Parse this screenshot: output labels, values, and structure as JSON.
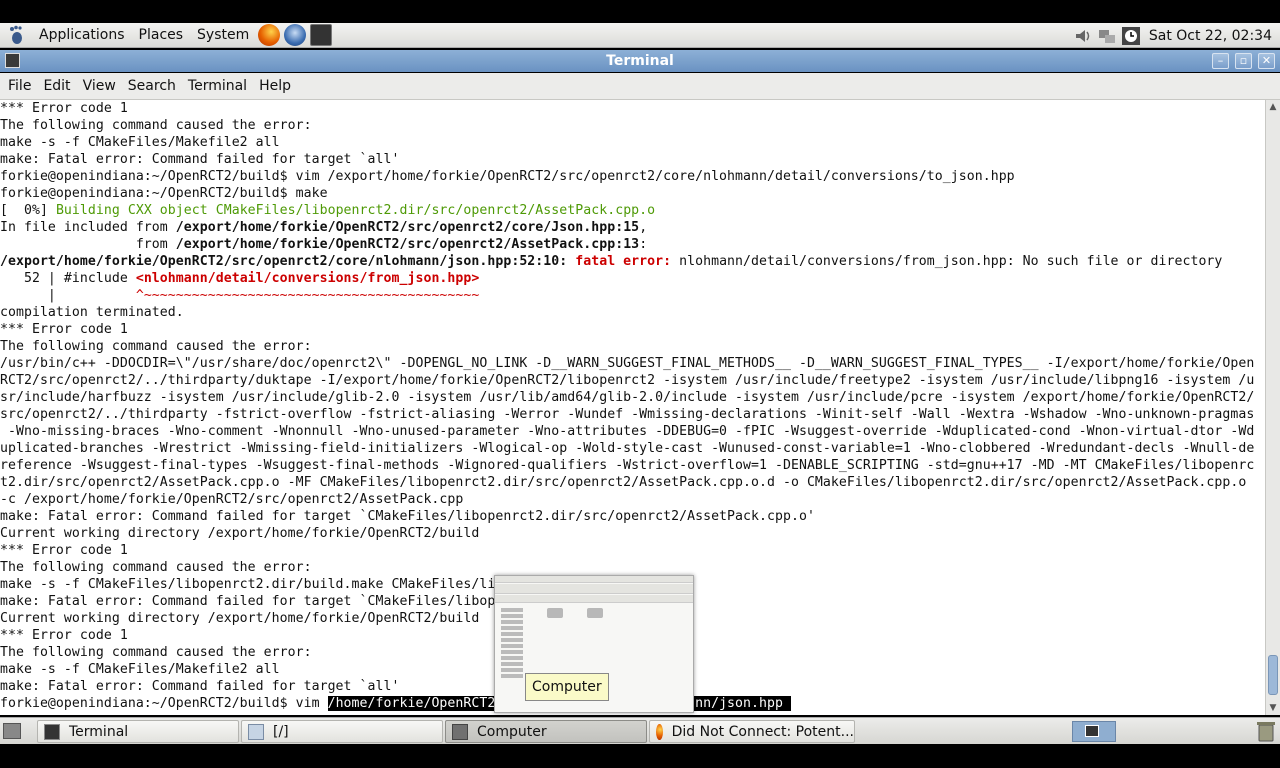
{
  "top_panel": {
    "menus": [
      "Applications",
      "Places",
      "System"
    ],
    "launchers": [
      "firefox-icon",
      "thunderbird-icon",
      "terminal-icon"
    ],
    "clock": "Sat Oct 22, 02:34"
  },
  "window": {
    "title": "Terminal",
    "menubar": [
      "File",
      "Edit",
      "View",
      "Search",
      "Terminal",
      "Help"
    ]
  },
  "terminal": {
    "lines": [
      [
        {
          "t": "*** Error code 1"
        }
      ],
      [
        {
          "t": "The following command caused the error:"
        }
      ],
      [
        {
          "t": "make -s -f CMakeFiles/Makefile2 all"
        }
      ],
      [
        {
          "t": "make: Fatal error: Command failed for target `all'"
        }
      ],
      [
        {
          "t": "forkie@openindiana:~/OpenRCT2/build$ vim /export/home/forkie/OpenRCT2/src/openrct2/core/nlohmann/detail/conversions/to_json.hpp"
        }
      ],
      [
        {
          "t": "forkie@openindiana:~/OpenRCT2/build$ make"
        }
      ],
      [
        {
          "t": "[  0%] "
        },
        {
          "t": "Building CXX object CMakeFiles/libopenrct2.dir/src/openrct2/AssetPack.cpp.o",
          "c": "green"
        }
      ],
      [
        {
          "t": "In file included from "
        },
        {
          "t": "/export/home/forkie/OpenRCT2/src/openrct2/core/Json.hpp:15",
          "c": "bold"
        },
        {
          "t": ","
        }
      ],
      [
        {
          "t": "                 from "
        },
        {
          "t": "/export/home/forkie/OpenRCT2/src/openrct2/AssetPack.cpp:13",
          "c": "bold"
        },
        {
          "t": ":"
        }
      ],
      [
        {
          "t": "/export/home/forkie/OpenRCT2/src/openrct2/core/nlohmann/json.hpp:52:10: ",
          "c": "bold"
        },
        {
          "t": "fatal error: ",
          "c": "redbold"
        },
        {
          "t": "nlohmann/detail/conversions/from_json.hpp: No such file or directory"
        }
      ],
      [
        {
          "t": "   52 | #include "
        },
        {
          "t": "<nlohmann/detail/conversions/from_json.hpp>",
          "c": "redbold"
        }
      ],
      [
        {
          "t": "      |          "
        },
        {
          "t": "^~~~~~~~~~~~~~~~~~~~~~~~~~~~~~~~~~~~~~~~~~~",
          "c": "red"
        }
      ],
      [
        {
          "t": "compilation terminated."
        }
      ],
      [
        {
          "t": "*** Error code 1"
        }
      ],
      [
        {
          "t": "The following command caused the error:"
        }
      ],
      [
        {
          "t": "/usr/bin/c++ -DDOCDIR=\\\"/usr/share/doc/openrct2\\\" -DOPENGL_NO_LINK -D__WARN_SUGGEST_FINAL_METHODS__ -D__WARN_SUGGEST_FINAL_TYPES__ -I/export/home/forkie/Open"
        }
      ],
      [
        {
          "t": "RCT2/src/openrct2/../thirdparty/duktape -I/export/home/forkie/OpenRCT2/libopenrct2 -isystem /usr/include/freetype2 -isystem /usr/include/libpng16 -isystem /u"
        }
      ],
      [
        {
          "t": "sr/include/harfbuzz -isystem /usr/include/glib-2.0 -isystem /usr/lib/amd64/glib-2.0/include -isystem /usr/include/pcre -isystem /export/home/forkie/OpenRCT2/"
        }
      ],
      [
        {
          "t": "src/openrct2/../thirdparty -fstrict-overflow -fstrict-aliasing -Werror -Wundef -Wmissing-declarations -Winit-self -Wall -Wextra -Wshadow -Wno-unknown-pragmas"
        }
      ],
      [
        {
          "t": " -Wno-missing-braces -Wno-comment -Wnonnull -Wno-unused-parameter -Wno-attributes -DDEBUG=0 -fPIC -Wsuggest-override -Wduplicated-cond -Wnon-virtual-dtor -Wd"
        }
      ],
      [
        {
          "t": "uplicated-branches -Wrestrict -Wmissing-field-initializers -Wlogical-op -Wold-style-cast -Wunused-const-variable=1 -Wno-clobbered -Wredundant-decls -Wnull-de"
        }
      ],
      [
        {
          "t": "reference -Wsuggest-final-types -Wsuggest-final-methods -Wignored-qualifiers -Wstrict-overflow=1 -DENABLE_SCRIPTING -std=gnu++17 -MD -MT CMakeFiles/libopenrc"
        }
      ],
      [
        {
          "t": "t2.dir/src/openrct2/AssetPack.cpp.o -MF CMakeFiles/libopenrct2.dir/src/openrct2/AssetPack.cpp.o.d -o CMakeFiles/libopenrct2.dir/src/openrct2/AssetPack.cpp.o"
        }
      ],
      [
        {
          "t": "-c /export/home/forkie/OpenRCT2/src/openrct2/AssetPack.cpp"
        }
      ],
      [
        {
          "t": "make: Fatal error: Command failed for target `CMakeFiles/libopenrct2.dir/src/openrct2/AssetPack.cpp.o'"
        }
      ],
      [
        {
          "t": "Current working directory /export/home/forkie/OpenRCT2/build"
        }
      ],
      [
        {
          "t": "*** Error code 1"
        }
      ],
      [
        {
          "t": "The following command caused the error:"
        }
      ],
      [
        {
          "t": "make -s -f CMakeFiles/libopenrct2.dir/build.make CMakeFiles/li"
        }
      ],
      [
        {
          "t": "make: Fatal error: Command failed for target `CMakeFiles/libop"
        }
      ],
      [
        {
          "t": "Current working directory /export/home/forkie/OpenRCT2/build"
        }
      ],
      [
        {
          "t": "*** Error code 1"
        }
      ],
      [
        {
          "t": "The following command caused the error:"
        }
      ],
      [
        {
          "t": "make -s -f CMakeFiles/Makefile2 all"
        }
      ],
      [
        {
          "t": "make: Fatal error: Command failed for target `all'"
        }
      ],
      [
        {
          "t": "forkie@openindiana:~/OpenRCT2/build$ vim "
        },
        {
          "t": "/home/forkie/OpenRCT2",
          "c": "sel"
        },
        {
          "t": "                        ",
          "c": "sel"
        },
        {
          "t": "ann/json.hpp ",
          "c": "sel"
        }
      ]
    ]
  },
  "preview": {
    "tooltip": "Computer"
  },
  "taskbar": {
    "tasks": [
      {
        "label": "Terminal",
        "icon": "terminal-icon"
      },
      {
        "label": "[/]",
        "icon": "folder-icon"
      },
      {
        "label": "Computer",
        "icon": "computer-icon"
      },
      {
        "label": "Did Not Connect: Potent...",
        "icon": "firefox-icon"
      }
    ]
  },
  "colors": {
    "titlebar": "#7a9ecb",
    "error_red": "#cc0000",
    "build_green": "#4e9a06",
    "tooltip_bg": "#fafac8"
  }
}
